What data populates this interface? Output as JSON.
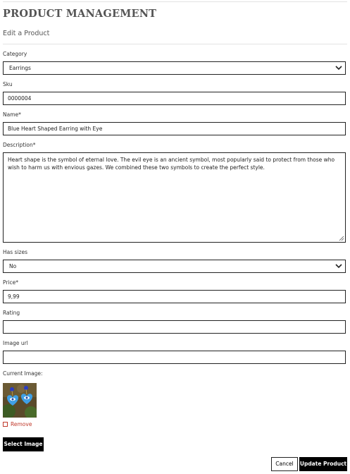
{
  "header": {
    "title": "PRODUCT MANAGEMENT",
    "subtitle": "Edit a Product"
  },
  "form": {
    "category": {
      "label": "Category",
      "value": "Earrings"
    },
    "sku": {
      "label": "Sku",
      "value": "0000004"
    },
    "name": {
      "label": "Name*",
      "value": "Blue Heart Shaped Earring with Eye"
    },
    "description": {
      "label": "Description*",
      "value": "Heart shape is the symbol of eternal love. The evil eye is an ancient symbol, most popularly said to protect from those who wish to harm us with envious gazes. We combined these two symbols to create the perfect style."
    },
    "has_sizes": {
      "label": "Has sizes",
      "value": "No"
    },
    "price": {
      "label": "Price*",
      "value": "9,99"
    },
    "rating": {
      "label": "Rating",
      "value": ""
    },
    "image_url": {
      "label": "Image url",
      "value": ""
    },
    "current_image": {
      "label": "Current Image:"
    },
    "remove": {
      "label": "Remove",
      "checked": false
    }
  },
  "buttons": {
    "select_image": "Select Image",
    "cancel": "Cancel",
    "update": "Update Product"
  },
  "colors": {
    "remove_red": "#c0392b",
    "button_dark": "#000000"
  },
  "icons": [
    "chevron-down-icon",
    "resize-grip-icon",
    "checkbox-icon"
  ]
}
